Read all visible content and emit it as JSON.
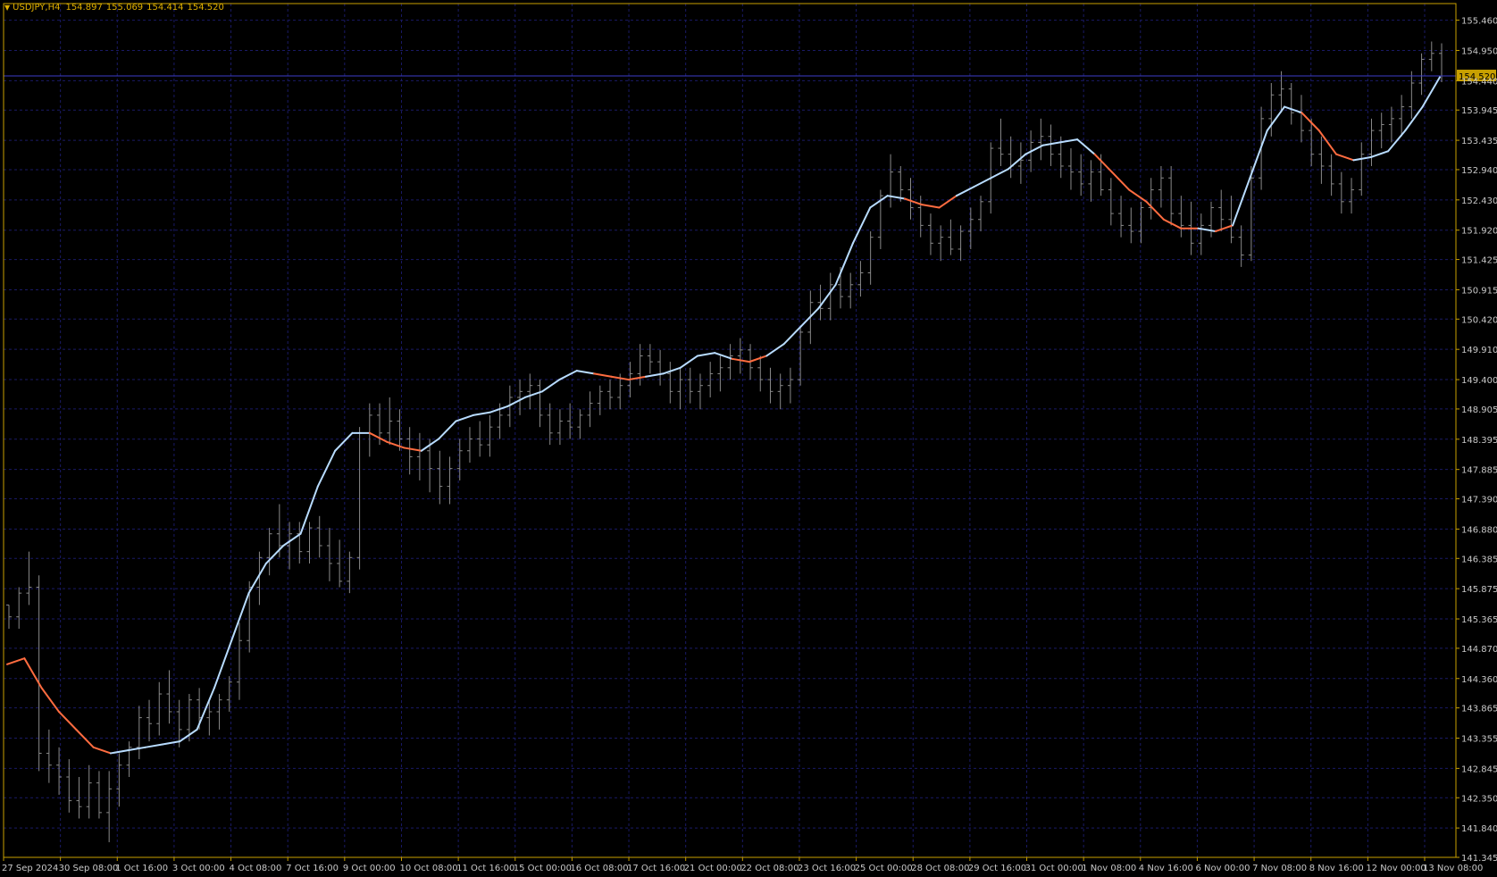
{
  "header": {
    "symbol": "USDJPY,H4",
    "open": "154.897",
    "high": "155.069",
    "low": "154.414",
    "close": "154.520"
  },
  "colors": {
    "background": "#000000",
    "frame": "#c8a000",
    "grid": "#1a1a66",
    "axis_text": "#c8c8c8",
    "bar": "#8a8a8a",
    "ma_up": "#b8dcff",
    "ma_down": "#ff6c40",
    "price_line": "#3c3cc8",
    "price_label_bg": "#c8a000",
    "header_text": "#e0b000"
  },
  "chart_data": {
    "type": "ohlc",
    "symbol": "USDJPY",
    "timeframe": "H4",
    "current_price": "154.520",
    "y_ticks": [
      "155.460",
      "154.950",
      "154.440",
      "153.945",
      "153.435",
      "152.940",
      "152.430",
      "151.920",
      "151.425",
      "150.915",
      "150.420",
      "149.910",
      "149.400",
      "148.905",
      "148.395",
      "147.885",
      "147.390",
      "146.880",
      "146.385",
      "145.875",
      "145.365",
      "144.870",
      "144.360",
      "143.865",
      "143.355",
      "142.845",
      "142.350",
      "141.840",
      "141.345"
    ],
    "x_ticks": [
      "27 Sep 2024",
      "30 Sep 08:00",
      "1 Oct 16:00",
      "3 Oct 00:00",
      "4 Oct 08:00",
      "7 Oct 16:00",
      "9 Oct 00:00",
      "10 Oct 08:00",
      "11 Oct 16:00",
      "15 Oct 00:00",
      "16 Oct 08:00",
      "17 Oct 16:00",
      "21 Oct 00:00",
      "22 Oct 08:00",
      "23 Oct 16:00",
      "25 Oct 00:00",
      "28 Oct 08:00",
      "29 Oct 16:00",
      "31 Oct 00:00",
      "1 Nov 08:00",
      "4 Nov 16:00",
      "6 Nov 00:00",
      "7 Nov 08:00",
      "8 Nov 16:00",
      "12 Nov 00:00",
      "13 Nov 08:00"
    ],
    "ylim": [
      141.345,
      155.74
    ],
    "grid": true,
    "series": [
      {
        "name": "",
        "kind": "ohlc",
        "bars": [
          [
            145.6,
            145.6,
            145.2,
            145.4
          ],
          [
            145.4,
            145.9,
            145.2,
            145.8
          ],
          [
            145.8,
            146.5,
            145.6,
            145.9
          ],
          [
            145.9,
            146.1,
            142.8,
            143.1
          ],
          [
            143.1,
            143.5,
            142.6,
            142.9
          ],
          [
            142.9,
            143.2,
            142.4,
            142.7
          ],
          [
            142.7,
            143.0,
            142.1,
            142.3
          ],
          [
            142.3,
            142.7,
            142.0,
            142.2
          ],
          [
            142.2,
            142.9,
            142.0,
            142.6
          ],
          [
            142.6,
            142.8,
            142.0,
            142.1
          ],
          [
            142.1,
            142.8,
            141.6,
            142.5
          ],
          [
            142.5,
            143.1,
            142.2,
            142.9
          ],
          [
            142.9,
            143.3,
            142.7,
            143.2
          ],
          [
            143.2,
            143.9,
            143.0,
            143.7
          ],
          [
            143.7,
            144.0,
            143.3,
            143.6
          ],
          [
            143.6,
            144.3,
            143.4,
            144.1
          ],
          [
            144.1,
            144.5,
            143.6,
            143.8
          ],
          [
            143.8,
            144.0,
            143.2,
            143.5
          ],
          [
            143.5,
            144.1,
            143.3,
            144.0
          ],
          [
            144.0,
            144.2,
            143.5,
            143.7
          ],
          [
            143.7,
            144.0,
            143.4,
            143.8
          ],
          [
            143.8,
            144.1,
            143.5,
            144.0
          ],
          [
            144.0,
            144.4,
            143.8,
            144.3
          ],
          [
            144.3,
            145.3,
            144.0,
            145.0
          ],
          [
            145.0,
            146.0,
            144.8,
            145.9
          ],
          [
            145.9,
            146.5,
            145.6,
            146.4
          ],
          [
            146.4,
            146.9,
            146.1,
            146.8
          ],
          [
            146.8,
            147.3,
            146.4,
            146.6
          ],
          [
            146.6,
            147.0,
            146.2,
            146.8
          ],
          [
            146.8,
            147.0,
            146.3,
            146.5
          ],
          [
            146.5,
            147.0,
            146.3,
            146.9
          ],
          [
            146.9,
            147.1,
            146.4,
            146.6
          ],
          [
            146.6,
            146.9,
            146.0,
            146.3
          ],
          [
            146.3,
            146.7,
            145.9,
            146.0
          ],
          [
            146.0,
            146.5,
            145.8,
            146.4
          ],
          [
            146.4,
            148.6,
            146.2,
            148.5
          ],
          [
            148.5,
            149.0,
            148.1,
            148.8
          ],
          [
            148.8,
            149.0,
            148.3,
            148.5
          ],
          [
            148.5,
            149.1,
            148.3,
            148.7
          ],
          [
            148.7,
            148.9,
            148.2,
            148.4
          ],
          [
            148.4,
            148.6,
            147.8,
            148.1
          ],
          [
            148.1,
            148.5,
            147.7,
            148.2
          ],
          [
            148.2,
            148.4,
            147.5,
            147.9
          ],
          [
            147.9,
            148.2,
            147.3,
            147.6
          ],
          [
            147.6,
            148.1,
            147.3,
            147.9
          ],
          [
            147.9,
            148.4,
            147.7,
            148.2
          ],
          [
            148.2,
            148.6,
            148.0,
            148.4
          ],
          [
            148.4,
            148.7,
            148.1,
            148.3
          ],
          [
            148.3,
            148.8,
            148.1,
            148.6
          ],
          [
            148.6,
            149.0,
            148.4,
            148.8
          ],
          [
            148.8,
            149.3,
            148.6,
            149.1
          ],
          [
            149.1,
            149.4,
            148.8,
            149.2
          ],
          [
            149.2,
            149.5,
            148.9,
            149.3
          ],
          [
            149.3,
            149.4,
            148.6,
            148.8
          ],
          [
            148.8,
            149.0,
            148.3,
            148.5
          ],
          [
            148.5,
            148.9,
            148.3,
            148.7
          ],
          [
            148.7,
            149.0,
            148.4,
            148.6
          ],
          [
            148.6,
            148.9,
            148.4,
            148.8
          ],
          [
            148.8,
            149.2,
            148.6,
            149.0
          ],
          [
            149.0,
            149.3,
            148.8,
            149.2
          ],
          [
            149.2,
            149.4,
            148.9,
            149.1
          ],
          [
            149.1,
            149.5,
            148.9,
            149.3
          ],
          [
            149.3,
            149.7,
            149.1,
            149.5
          ],
          [
            149.5,
            150.0,
            149.3,
            149.8
          ],
          [
            149.8,
            150.0,
            149.5,
            149.7
          ],
          [
            149.7,
            149.9,
            149.3,
            149.5
          ],
          [
            149.5,
            149.7,
            149.0,
            149.2
          ],
          [
            149.2,
            149.6,
            148.9,
            149.4
          ],
          [
            149.4,
            149.6,
            149.0,
            149.2
          ],
          [
            149.2,
            149.5,
            148.9,
            149.3
          ],
          [
            149.3,
            149.7,
            149.1,
            149.5
          ],
          [
            149.5,
            149.8,
            149.2,
            149.6
          ],
          [
            149.6,
            150.0,
            149.4,
            149.8
          ],
          [
            149.8,
            150.1,
            149.5,
            149.9
          ],
          [
            149.9,
            150.0,
            149.4,
            149.6
          ],
          [
            149.6,
            149.8,
            149.2,
            149.4
          ],
          [
            149.4,
            149.6,
            149.0,
            149.2
          ],
          [
            149.2,
            149.5,
            148.9,
            149.3
          ],
          [
            149.3,
            149.6,
            149.0,
            149.4
          ],
          [
            149.4,
            150.3,
            149.3,
            150.2
          ],
          [
            150.2,
            150.9,
            150.0,
            150.7
          ],
          [
            150.7,
            151.0,
            150.4,
            150.6
          ],
          [
            150.6,
            151.2,
            150.4,
            151.0
          ],
          [
            151.0,
            151.3,
            150.6,
            150.8
          ],
          [
            150.8,
            151.2,
            150.6,
            151.0
          ],
          [
            151.0,
            151.4,
            150.8,
            151.2
          ],
          [
            151.2,
            151.9,
            151.0,
            151.8
          ],
          [
            151.8,
            152.6,
            151.6,
            152.5
          ],
          [
            152.5,
            153.2,
            152.3,
            152.9
          ],
          [
            152.9,
            153.0,
            152.4,
            152.6
          ],
          [
            152.6,
            152.8,
            152.1,
            152.3
          ],
          [
            152.3,
            152.5,
            151.8,
            152.0
          ],
          [
            152.0,
            152.2,
            151.5,
            151.7
          ],
          [
            151.7,
            152.0,
            151.4,
            151.8
          ],
          [
            151.8,
            152.1,
            151.5,
            151.6
          ],
          [
            151.6,
            152.0,
            151.4,
            151.9
          ],
          [
            151.9,
            152.3,
            151.6,
            152.1
          ],
          [
            152.1,
            152.5,
            151.9,
            152.4
          ],
          [
            152.4,
            153.4,
            152.2,
            153.3
          ],
          [
            153.3,
            153.8,
            153.0,
            153.2
          ],
          [
            153.2,
            153.5,
            152.8,
            153.0
          ],
          [
            153.0,
            153.4,
            152.7,
            153.1
          ],
          [
            153.1,
            153.6,
            152.9,
            153.4
          ],
          [
            153.4,
            153.8,
            153.1,
            153.5
          ],
          [
            153.5,
            153.7,
            153.0,
            153.2
          ],
          [
            153.2,
            153.5,
            152.8,
            153.0
          ],
          [
            153.0,
            153.3,
            152.6,
            152.9
          ],
          [
            152.9,
            153.2,
            152.5,
            152.7
          ],
          [
            152.7,
            153.1,
            152.4,
            152.9
          ],
          [
            152.9,
            153.2,
            152.5,
            152.6
          ],
          [
            152.6,
            152.8,
            152.0,
            152.2
          ],
          [
            152.2,
            152.5,
            151.8,
            152.0
          ],
          [
            152.0,
            152.3,
            151.7,
            151.9
          ],
          [
            151.9,
            152.4,
            151.7,
            152.3
          ],
          [
            152.3,
            152.8,
            152.1,
            152.6
          ],
          [
            152.6,
            153.0,
            152.3,
            152.8
          ],
          [
            152.8,
            153.0,
            152.0,
            152.2
          ],
          [
            152.2,
            152.5,
            151.8,
            152.0
          ],
          [
            152.0,
            152.4,
            151.5,
            151.7
          ],
          [
            151.7,
            152.2,
            151.5,
            152.0
          ],
          [
            152.0,
            152.4,
            151.8,
            152.3
          ],
          [
            152.3,
            152.6,
            151.9,
            152.1
          ],
          [
            152.1,
            152.5,
            151.7,
            151.8
          ],
          [
            151.8,
            152.0,
            151.3,
            151.5
          ],
          [
            151.5,
            153.0,
            151.4,
            152.8
          ],
          [
            152.8,
            154.0,
            152.6,
            153.8
          ],
          [
            153.8,
            154.4,
            153.5,
            154.2
          ],
          [
            154.2,
            154.6,
            153.9,
            154.3
          ],
          [
            154.3,
            154.4,
            153.7,
            153.9
          ],
          [
            153.9,
            154.2,
            153.4,
            153.6
          ],
          [
            153.6,
            153.8,
            153.0,
            153.2
          ],
          [
            153.2,
            153.5,
            152.7,
            153.0
          ],
          [
            153.0,
            153.2,
            152.5,
            152.7
          ],
          [
            152.7,
            152.9,
            152.2,
            152.4
          ],
          [
            152.4,
            152.8,
            152.2,
            152.6
          ],
          [
            152.6,
            153.4,
            152.5,
            153.2
          ],
          [
            153.2,
            153.8,
            153.0,
            153.6
          ],
          [
            153.6,
            153.9,
            153.3,
            153.7
          ],
          [
            153.7,
            154.0,
            153.4,
            153.8
          ],
          [
            153.8,
            154.2,
            153.5,
            154.0
          ],
          [
            154.0,
            154.6,
            153.8,
            154.4
          ],
          [
            154.4,
            154.9,
            154.2,
            154.8
          ],
          [
            154.8,
            155.1,
            154.6,
            154.9
          ],
          [
            154.9,
            155.069,
            154.414,
            154.52
          ]
        ]
      },
      {
        "name": "",
        "kind": "moving_average",
        "values": [
          144.6,
          144.7,
          144.2,
          143.8,
          143.5,
          143.2,
          143.1,
          143.15,
          143.2,
          143.25,
          143.3,
          143.5,
          144.2,
          145.0,
          145.8,
          146.3,
          146.6,
          146.8,
          147.6,
          148.2,
          148.5,
          148.5,
          148.35,
          148.25,
          148.2,
          148.4,
          148.7,
          148.8,
          148.85,
          148.95,
          149.1,
          149.2,
          149.4,
          149.55,
          149.5,
          149.45,
          149.4,
          149.45,
          149.5,
          149.6,
          149.8,
          149.85,
          149.75,
          149.7,
          149.8,
          150.0,
          150.3,
          150.6,
          151.0,
          151.7,
          152.3,
          152.5,
          152.45,
          152.35,
          152.3,
          152.5,
          152.65,
          152.8,
          152.95,
          153.2,
          153.35,
          153.4,
          153.45,
          153.2,
          152.9,
          152.6,
          152.4,
          152.1,
          151.95,
          151.95,
          151.9,
          152.0,
          152.8,
          153.6,
          154.0,
          153.9,
          153.6,
          153.2,
          153.1,
          153.15,
          153.25,
          153.6,
          154.0,
          154.5
        ],
        "segment_colors": [
          "down",
          "down",
          "down",
          "down",
          "down",
          "down",
          "up",
          "up",
          "up",
          "up",
          "up",
          "up",
          "up",
          "up",
          "up",
          "up",
          "up",
          "up",
          "up",
          "up",
          "up",
          "down",
          "down",
          "down",
          "up",
          "up",
          "up",
          "up",
          "up",
          "up",
          "up",
          "up",
          "up",
          "up",
          "down",
          "down",
          "down",
          "up",
          "up",
          "up",
          "up",
          "up",
          "down",
          "down",
          "up",
          "up",
          "up",
          "up",
          "up",
          "up",
          "up",
          "up",
          "down",
          "down",
          "down",
          "up",
          "up",
          "up",
          "up",
          "up",
          "up",
          "up",
          "up",
          "down",
          "down",
          "down",
          "down",
          "down",
          "down",
          "up",
          "down",
          "up",
          "up",
          "up",
          "up",
          "down",
          "down",
          "down",
          "up",
          "up",
          "up",
          "up",
          "up",
          "up"
        ]
      }
    ]
  }
}
